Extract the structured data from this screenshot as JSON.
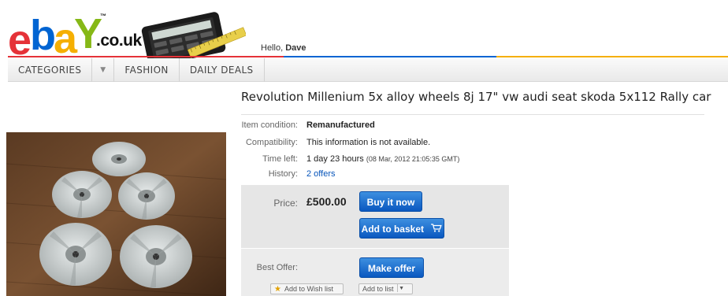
{
  "header": {
    "logo_letters": [
      "e",
      "b",
      "a",
      "Y"
    ],
    "logo_suffix": ".co.uk",
    "logo_tm": "™",
    "greeting": "Hello,",
    "user_name": "Dave"
  },
  "nav": {
    "items": [
      "CATEGORIES",
      "FASHION",
      "DAILY DEALS"
    ],
    "dropdown_icon": "▼"
  },
  "listing": {
    "title": "Revolution Millenium 5x alloy wheels 8j 17\" vw audi seat skoda 5x112 Rally car",
    "condition_label": "Item condition:",
    "condition_value": "Remanufactured",
    "compat_label": "Compatibility:",
    "compat_value": "This information is not available.",
    "time_label": "Time left:",
    "time_value": "1 day 23 hours",
    "time_detail": "(08 Mar, 2012 21:05:35 GMT)",
    "history_label": "History:",
    "history_value": "2 offers"
  },
  "purchase": {
    "price_label": "Price:",
    "price_value": "£500.00",
    "buy_now": "Buy it now",
    "add_basket": "Add to basket",
    "best_offer_label": "Best Offer:",
    "make_offer": "Make offer",
    "wish_list": "Add to Wish list",
    "add_list": "Add to list"
  },
  "icons": {
    "cart": "cart-icon",
    "star": "star-icon",
    "dropdown": "chevron-down-icon"
  },
  "colors": {
    "ebay_red": "#e53238",
    "ebay_blue": "#0064d2",
    "ebay_yellow": "#f5af02",
    "ebay_green": "#86b817",
    "button_blue": "#0a58c0",
    "link_blue": "#0654ba"
  }
}
